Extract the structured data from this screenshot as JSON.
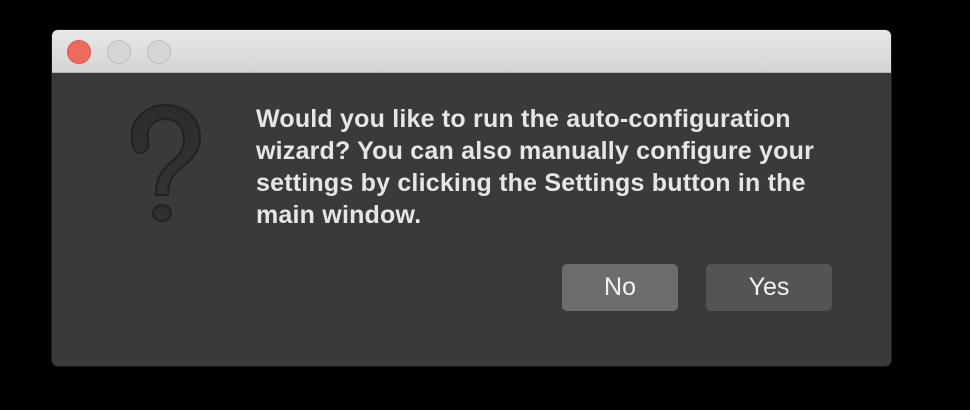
{
  "dialog": {
    "message": "Would you like to run the auto-configuration wizard? You can also manually configure your settings by clicking the Settings button in the main window.",
    "icon": "question-mark-icon",
    "buttons": {
      "no_label": "No",
      "yes_label": "Yes"
    }
  },
  "colors": {
    "close": "#ee6a5f",
    "window_bg": "#3a3a3a",
    "no_button_bg": "#6d6d6d",
    "yes_button_bg": "#545454"
  }
}
